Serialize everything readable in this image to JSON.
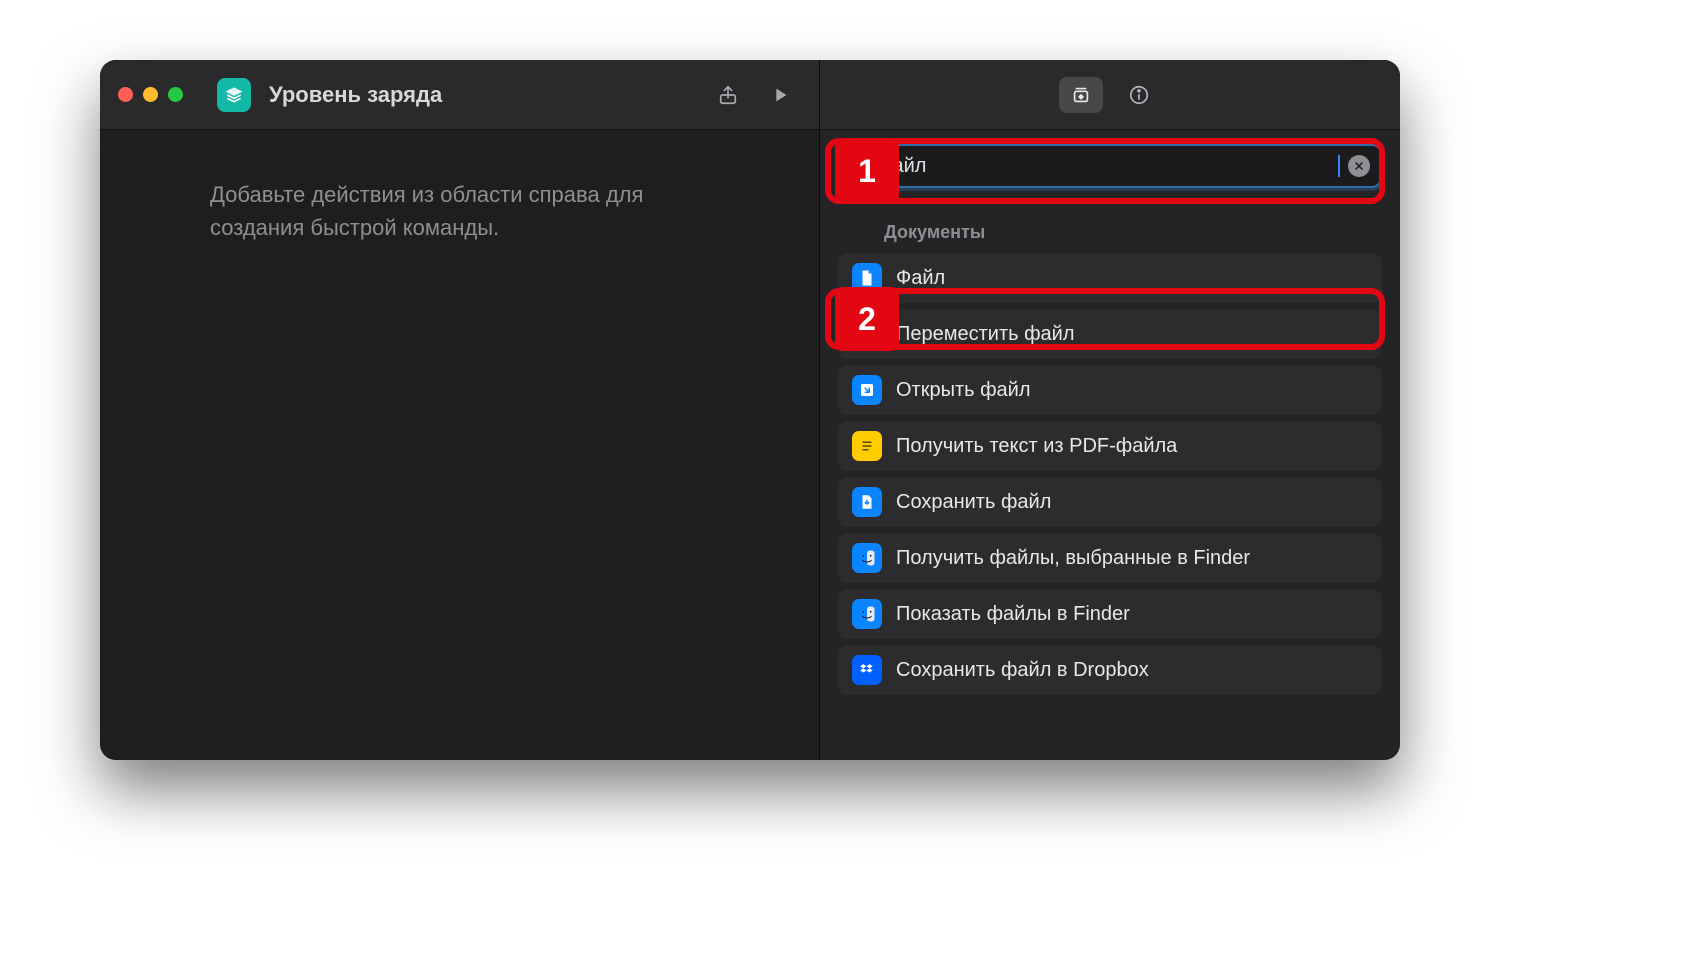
{
  "window": {
    "title": "Уровень заряда"
  },
  "canvas": {
    "hint": "Добавьте действия из области справа для создания быстрой команды."
  },
  "search": {
    "value": "файл"
  },
  "results": {
    "section_title": "Документы",
    "items": [
      {
        "label": "Файл",
        "icon": "file",
        "color": "blue"
      },
      {
        "label": "Переместить файл",
        "icon": "move",
        "color": "blue"
      },
      {
        "label": "Открыть файл",
        "icon": "open",
        "color": "blue"
      },
      {
        "label": "Получить текст из PDF-файла",
        "icon": "pdf",
        "color": "yellow"
      },
      {
        "label": "Сохранить файл",
        "icon": "save",
        "color": "blue"
      },
      {
        "label": "Получить файлы, выбранные в Finder",
        "icon": "finder",
        "color": "finder"
      },
      {
        "label": "Показать файлы в Finder",
        "icon": "finder",
        "color": "finder"
      },
      {
        "label": "Сохранить файл в Dropbox",
        "icon": "dropbox",
        "color": "dropbox"
      }
    ]
  },
  "annotations": {
    "one": "1",
    "two": "2"
  }
}
